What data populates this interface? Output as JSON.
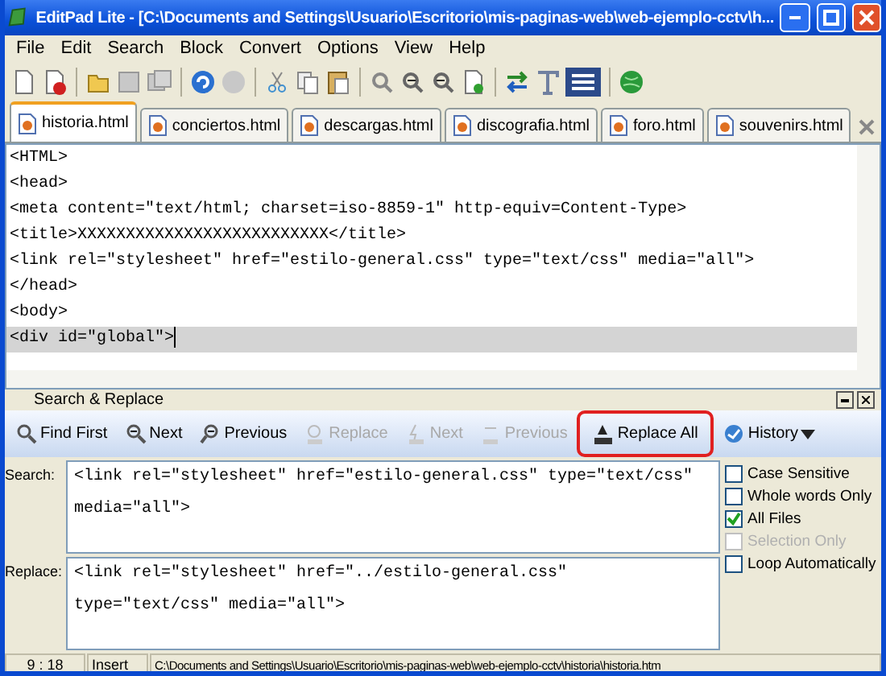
{
  "window": {
    "title": "EditPad Lite - [C:\\Documents and Settings\\Usuario\\Escritorio\\mis-paginas-web\\web-ejemplo-cctv\\h..."
  },
  "menu": [
    "File",
    "Edit",
    "Search",
    "Block",
    "Convert",
    "Options",
    "View",
    "Help"
  ],
  "tabs": [
    {
      "label": "historia.html",
      "selected": true
    },
    {
      "label": "conciertos.html",
      "selected": false
    },
    {
      "label": "descargas.html",
      "selected": false
    },
    {
      "label": "discografia.html",
      "selected": false
    },
    {
      "label": "foro.html",
      "selected": false
    },
    {
      "label": "souvenirs.html",
      "selected": false
    }
  ],
  "editor": {
    "lines": [
      {
        "text": "<HTML>",
        "current": false
      },
      {
        "text": "<head>",
        "current": false
      },
      {
        "text": "<meta content=\"text/html; charset=iso-8859-1\" http-equiv=Content-Type>",
        "current": false
      },
      {
        "text": "<title>XXXXXXXXXXXXXXXXXXXXXXXXXX</title>",
        "current": false
      },
      {
        "text": "<link rel=\"stylesheet\" href=\"estilo-general.css\" type=\"text/css\" media=\"all\">",
        "current": false
      },
      {
        "text": "</head>",
        "current": false
      },
      {
        "text": "<body>",
        "current": false
      },
      {
        "text": "<div id=\"global\">",
        "current": true
      }
    ]
  },
  "search_panel": {
    "title": "Search & Replace",
    "buttons": [
      {
        "label": "Find First",
        "disabled": false,
        "highlighted": false
      },
      {
        "label": "Next",
        "disabled": false,
        "highlighted": false
      },
      {
        "label": "Previous",
        "disabled": false,
        "highlighted": false
      },
      {
        "label": "Replace",
        "disabled": true,
        "highlighted": false
      },
      {
        "label": "Next",
        "disabled": true,
        "highlighted": false
      },
      {
        "label": "Previous",
        "disabled": true,
        "highlighted": false
      },
      {
        "label": "Replace All",
        "disabled": false,
        "highlighted": true
      },
      {
        "label": "History",
        "disabled": false,
        "highlighted": false
      }
    ],
    "search_label": "Search:",
    "search_value": "<link rel=\"stylesheet\" href=\"estilo-general.css\" type=\"text/css\" media=\"all\">",
    "replace_label": "Replace:",
    "replace_value": "<link rel=\"stylesheet\" href=\"../estilo-general.css\" type=\"text/css\" media=\"all\">",
    "options": [
      {
        "label": "Case Sensitive",
        "checked": false,
        "disabled": false
      },
      {
        "label": "Whole words Only",
        "checked": false,
        "disabled": false
      },
      {
        "label": "All Files",
        "checked": true,
        "disabled": false
      },
      {
        "label": "Selection Only",
        "checked": false,
        "disabled": true
      },
      {
        "label": "Loop Automatically",
        "checked": false,
        "disabled": false
      }
    ]
  },
  "status_bar": {
    "position": "9 : 18",
    "mode": "Insert",
    "path": "C:\\Documents and Settings\\Usuario\\Escritorio\\mis-paginas-web\\web-ejemplo-cctv\\historia\\historia.htm"
  }
}
